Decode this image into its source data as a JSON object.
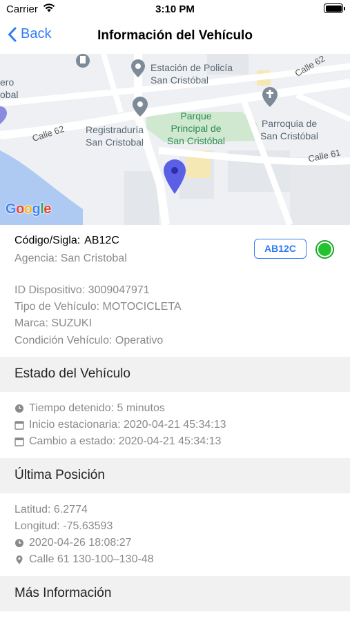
{
  "status_bar": {
    "carrier": "Carrier",
    "time": "3:10 PM"
  },
  "nav": {
    "back_label": "Back",
    "title": "Información del Vehículo"
  },
  "map": {
    "pois": {
      "police": "Estación de Policía\nSan Cristóbal",
      "registraduria": "Registraduría\nSan Cristobal",
      "parque": "Parque\nPrincipal de\nSan Cristóbal",
      "parroquia": "Parroquia de\nSan Cristóbal",
      "edge_label": "ero\nobal"
    },
    "streets": {
      "calle62_left": "Calle 62",
      "calle62_right": "Calle 62",
      "calle61": "Calle 61"
    },
    "logo": "Google"
  },
  "vehicle": {
    "code_label": "Código/Sigla:",
    "code_value": "AB12C",
    "agency": "Agencia: San Cristobal",
    "badge": "AB12C",
    "status_color": "#25c22f",
    "device_id": "ID Dispositivo: 3009047971",
    "type": "Tipo de Vehículo: MOTOCICLETA",
    "brand": "Marca: SUZUKI",
    "condition": "Condición Vehículo: Operativo"
  },
  "estado": {
    "header": "Estado del Vehículo",
    "stopped": "Tiempo detenido: 5 minutos",
    "stationary_start": "Inicio estacionaria: 2020-04-21 45:34:13",
    "state_change": "Cambio a estado: 2020-04-21 45:34:13"
  },
  "posicion": {
    "header": "Última Posición",
    "lat": "Latitud: 6.2774",
    "lon": "Longitud: -75.63593",
    "time": "2020-04-26 18:08:27",
    "address": "Calle 61 130-100–130-48"
  },
  "mas": {
    "header": "Más Información"
  },
  "colors": {
    "accent": "#2f7cf6",
    "status_green": "#25c22f"
  }
}
